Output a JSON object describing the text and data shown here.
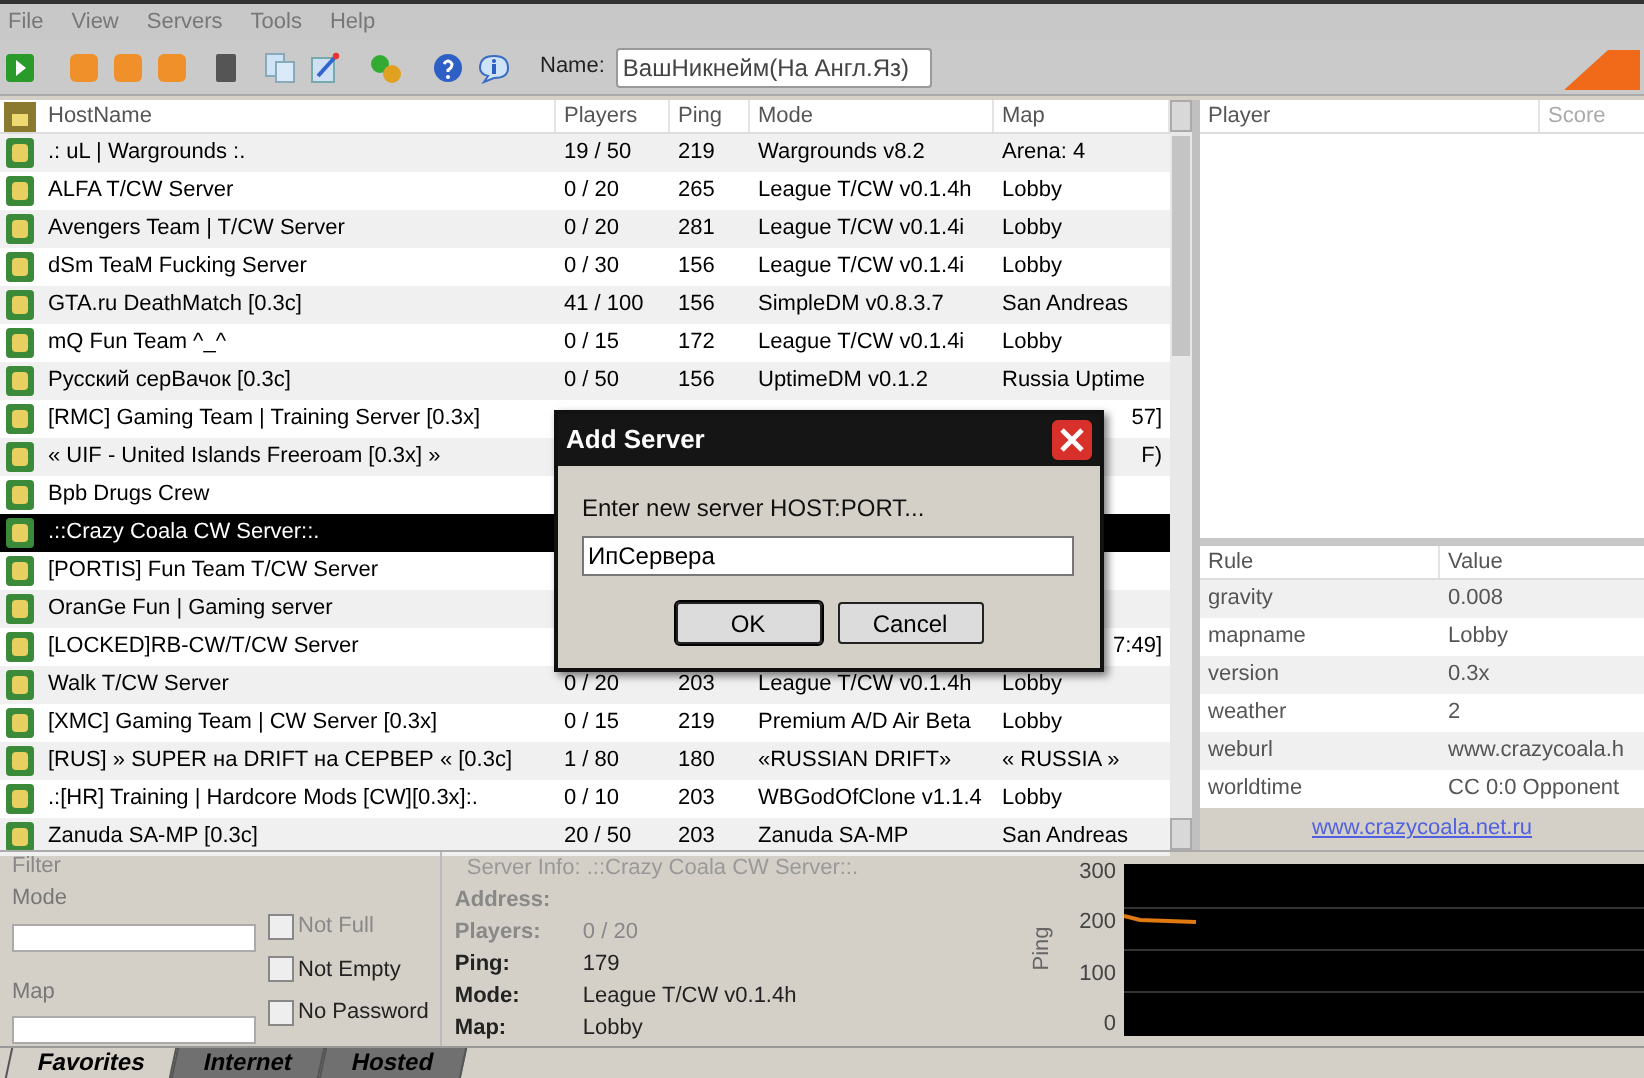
{
  "menu": [
    "File",
    "View",
    "Servers",
    "Tools",
    "Help"
  ],
  "toolbar": {
    "name_label": "Name:",
    "name_value": "ВашНикнейм(На Англ.Яз)"
  },
  "server_list": {
    "columns": [
      "HostName",
      "Players",
      "Ping",
      "Mode",
      "Map"
    ],
    "rows": [
      {
        "hostname": ".: uL | Wargrounds :.",
        "players": "19 / 50",
        "ping": "219",
        "mode": "Wargrounds v8.2",
        "map": "Arena: 4",
        "selected": false
      },
      {
        "hostname": "ALFA T/CW Server",
        "players": "0 / 20",
        "ping": "265",
        "mode": "League T/CW v0.1.4h",
        "map": "Lobby",
        "selected": false
      },
      {
        "hostname": "Avengers Team | T/CW Server",
        "players": "0 / 20",
        "ping": "281",
        "mode": "League T/CW v0.1.4i",
        "map": "Lobby",
        "selected": false
      },
      {
        "hostname": "dSm TeaM Fucking Server",
        "players": "0 / 30",
        "ping": "156",
        "mode": "League T/CW v0.1.4i",
        "map": "Lobby",
        "selected": false
      },
      {
        "hostname": "GTA.ru DeathMatch [0.3c]",
        "players": "41 / 100",
        "ping": "156",
        "mode": "SimpleDM v0.8.3.7",
        "map": "San Andreas",
        "selected": false
      },
      {
        "hostname": "mQ Fun Team ^_^",
        "players": "0 / 15",
        "ping": "172",
        "mode": "League T/CW v0.1.4i",
        "map": "Lobby",
        "selected": false
      },
      {
        "hostname": "Русский серВачок [0.3c]",
        "players": "0 / 50",
        "ping": "156",
        "mode": "UptimeDM v0.1.2",
        "map": "Russia Uptime",
        "selected": false
      },
      {
        "hostname": "[RMC] Gaming Team | Training Server [0.3x]",
        "map_tail": "57]",
        "selected": false
      },
      {
        "hostname": "« UIF - United Islands Freeroam [0.3x] »",
        "map_tail": "F)",
        "selected": false
      },
      {
        "hostname": "Bpb Drugs Crew",
        "selected": false
      },
      {
        "hostname": ".::Crazy Coala CW Server::.",
        "selected": true
      },
      {
        "hostname": "[PORTIS] Fun Team T/CW Server",
        "selected": false
      },
      {
        "hostname": "OranGe Fun | Gaming server",
        "selected": false
      },
      {
        "hostname": "[LOCKED]RB-CW/T/CW Server",
        "map_tail": "7:49]",
        "selected": false
      },
      {
        "hostname": "Walk T/CW Server",
        "players": "0 / 20",
        "ping": "203",
        "mode": "League T/CW v0.1.4h",
        "map": "Lobby",
        "selected": false
      },
      {
        "hostname": "[XMC] Gaming Team | CW Server [0.3x]",
        "players": "0 / 15",
        "ping": "219",
        "mode": "Premium A/D Air Beta",
        "map": "Lobby",
        "selected": false
      },
      {
        "hostname": "[RUS] » SUPER на DRIFT на СЕРВЕР « [0.3c]",
        "players": "1 / 80",
        "ping": "180",
        "mode": "«RUSSIAN DRIFT»",
        "map": "« RUSSIA »",
        "selected": false
      },
      {
        "hostname": ".:[HR] Training | Hardcore Mods [CW][0.3x]:.",
        "players": "0 / 10",
        "ping": "203",
        "mode": "WBGodOfClone v1.1.4",
        "map": "Lobby",
        "selected": false
      },
      {
        "hostname": "Zanuda SA-MP [0.3c]",
        "players": "20 / 50",
        "ping": "203",
        "mode": "Zanuda SA-MP",
        "map": "San Andreas",
        "selected": false
      }
    ]
  },
  "players_panel": {
    "columns": [
      "Player",
      "Score"
    ]
  },
  "rules_panel": {
    "columns": [
      "Rule",
      "Value"
    ],
    "rows": [
      {
        "rule": "gravity",
        "value": "0.008"
      },
      {
        "rule": "mapname",
        "value": "Lobby"
      },
      {
        "rule": "version",
        "value": "0.3x"
      },
      {
        "rule": "weather",
        "value": "2"
      },
      {
        "rule": "weburl",
        "value": "www.crazycoala.h"
      },
      {
        "rule": "worldtime",
        "value": "CC 0:0 Opponent"
      }
    ],
    "link": "www.crazycoala.net.ru"
  },
  "filter": {
    "title": "Filter",
    "mode_label": "Mode",
    "map_label": "Map",
    "options": [
      {
        "label": "Not Full",
        "checked": false
      },
      {
        "label": "Not Empty",
        "checked": false
      },
      {
        "label": "No Password",
        "checked": false
      }
    ]
  },
  "server_info": {
    "title": "Server Info: .::Crazy Coala CW Server::.",
    "fields": [
      {
        "label": "Address:"
      },
      {
        "label": "Players:",
        "value": "0 / 20"
      },
      {
        "label": "Ping:",
        "value": "179"
      },
      {
        "label": "Mode:",
        "value": "League T/CW v0.1.4h"
      },
      {
        "label": "Map:",
        "value": "Lobby"
      }
    ]
  },
  "ping_chart": {
    "ylabel": "Ping",
    "yticks": [
      "300",
      "200",
      "100",
      "0"
    ]
  },
  "tabs": [
    {
      "label": "Favorites",
      "selected": true
    },
    {
      "label": "Internet",
      "selected": false
    },
    {
      "label": "Hosted",
      "selected": false
    }
  ],
  "dialog": {
    "title": "Add Server",
    "prompt": "Enter new server HOST:PORT...",
    "value": "ИпСервера",
    "buttons": [
      "OK",
      "Cancel"
    ]
  }
}
